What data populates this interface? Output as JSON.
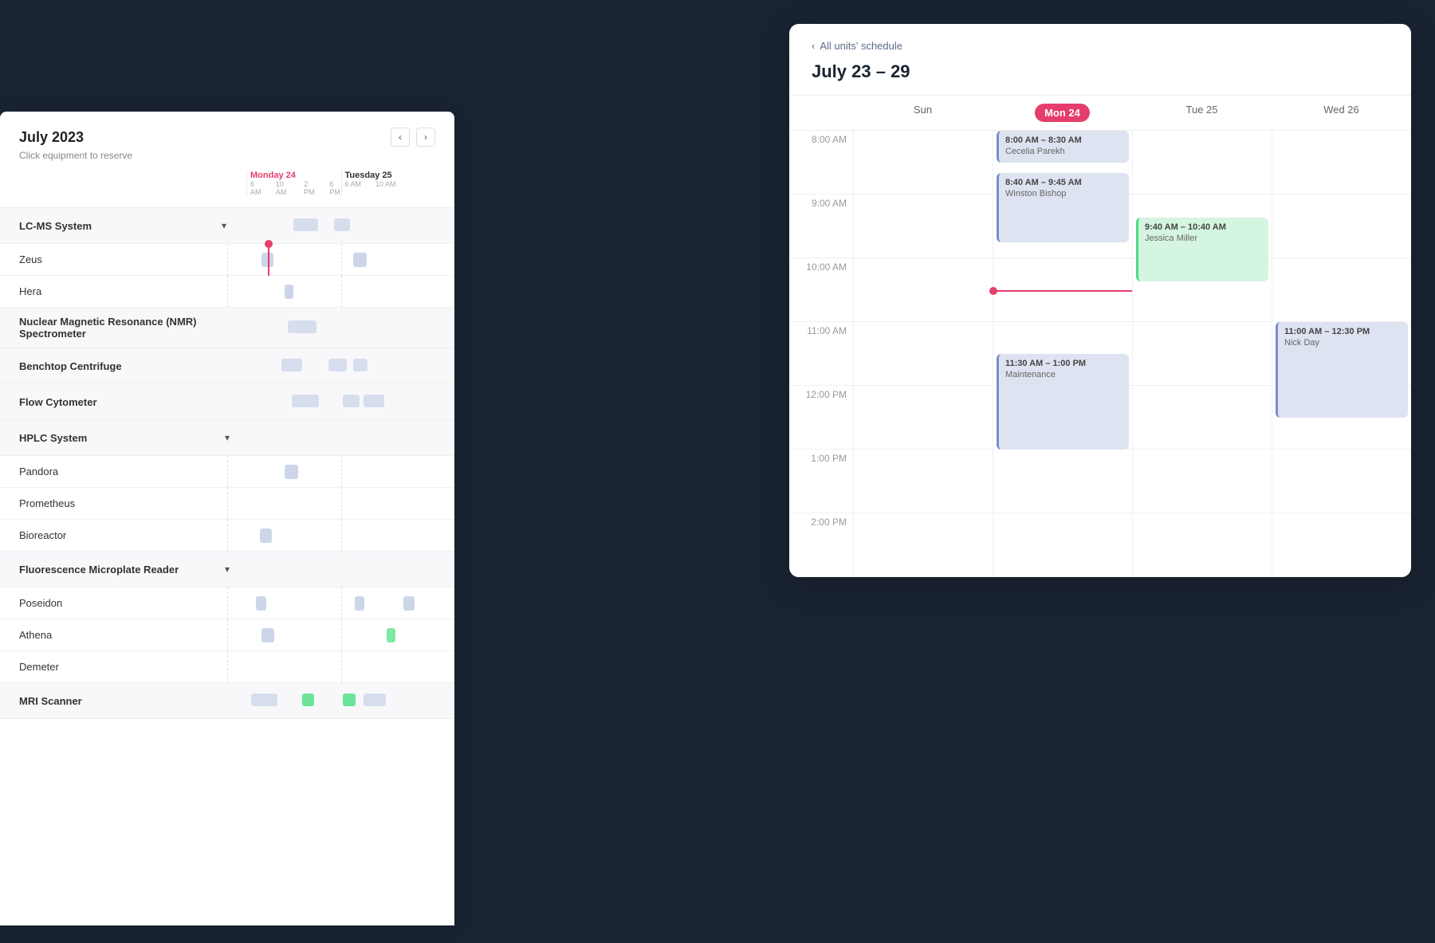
{
  "leftPanel": {
    "monthTitle": "July 2023",
    "clickHint": "Click equipment to reserve",
    "currentDayLabel": "Monday 24",
    "nextDayLabel": "Tuesday 25",
    "timeTicks": [
      "6 AM",
      "10 AM",
      "2 PM",
      "6 PM"
    ],
    "groups": [
      {
        "name": "LC-MS System",
        "items": [
          {
            "name": "Zeus"
          },
          {
            "name": "Hera"
          }
        ]
      },
      {
        "name": "Nuclear Magnetic Resonance (NMR) Spectrometer",
        "items": []
      },
      {
        "name": "Benchtop Centrifuge",
        "items": []
      },
      {
        "name": "Flow Cytometer",
        "items": []
      },
      {
        "name": "HPLC System",
        "items": [
          {
            "name": "Pandora"
          },
          {
            "name": "Prometheus"
          },
          {
            "name": "Bioreactor"
          }
        ]
      },
      {
        "name": "Fluorescence Microplate Reader",
        "items": [
          {
            "name": "Poseidon"
          },
          {
            "name": "Athena"
          },
          {
            "name": "Demeter"
          }
        ]
      },
      {
        "name": "MRI Scanner",
        "items": []
      }
    ]
  },
  "rightPanel": {
    "backLabel": "All units' schedule",
    "dateRange": "July 23 – 29",
    "days": [
      {
        "label": "Sun",
        "number": ""
      },
      {
        "label": "Mon 24",
        "number": "24",
        "isToday": true
      },
      {
        "label": "Tue 25",
        "number": ""
      },
      {
        "label": "Wed 26",
        "number": ""
      }
    ],
    "events": [
      {
        "day": 1,
        "startHour": 8,
        "startMin": 0,
        "endHour": 8,
        "endMin": 30,
        "timeLabel": "8:00 AM – 8:30 AM",
        "person": "Cecelia Parekh",
        "type": "blue"
      },
      {
        "day": 1,
        "startHour": 8,
        "startMin": 40,
        "endHour": 9,
        "endMin": 45,
        "timeLabel": "8:40 AM – 9:45 AM",
        "person": "Winston Bishop",
        "type": "blue"
      },
      {
        "day": 2,
        "startHour": 9,
        "startMin": 40,
        "endHour": 10,
        "endMin": 40,
        "timeLabel": "9:40 AM – 10:40 AM",
        "person": "Jessica Miller",
        "type": "green"
      },
      {
        "day": 1,
        "startHour": 11,
        "startMin": 30,
        "endHour": 13,
        "endMin": 0,
        "timeLabel": "11:30 AM – 1:00 PM",
        "person": "Maintenance",
        "type": "blue"
      },
      {
        "day": 3,
        "startHour": 11,
        "startMin": 0,
        "endHour": 12,
        "endMin": 30,
        "timeLabel": "11:00 AM – 12:30 PM",
        "person": "Nick Day",
        "type": "blue"
      }
    ],
    "times": [
      "8:00 AM",
      "9:00 AM",
      "10:00 AM",
      "11:00 AM",
      "12:00 PM",
      "1:00 PM",
      "2:00 PM"
    ]
  },
  "icons": {
    "chevronLeft": "‹",
    "chevronRight": "›",
    "chevronDown": "▾"
  }
}
